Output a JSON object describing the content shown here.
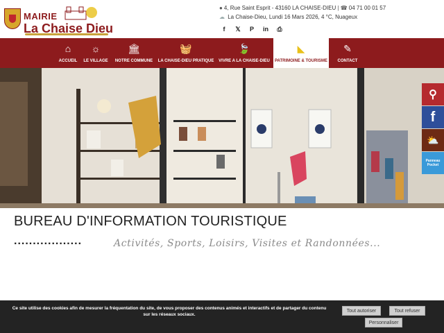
{
  "logo": {
    "mairie": "MAIRIE",
    "name": "La Chaise Dieu"
  },
  "contact": {
    "address": "4, Rue Saint Esprit - 43160 LA CHAISE-DIEU",
    "phone": "04 71 00 01 57",
    "weather_line": "La Chaise-Dieu, Lundi 16 Mars 2026, 4 °C, Nuageux"
  },
  "socials": [
    {
      "name": "facebook-icon",
      "glyph": "f"
    },
    {
      "name": "x-icon",
      "glyph": "𝕏"
    },
    {
      "name": "pinterest-icon",
      "glyph": "P"
    },
    {
      "name": "linkedin-icon",
      "glyph": "in"
    },
    {
      "name": "print-icon",
      "glyph": "⎙"
    }
  ],
  "nav": [
    {
      "label": "ACCUEIL",
      "icon": "home-icon",
      "glyph": "⌂"
    },
    {
      "label": "LE VILLAGE",
      "icon": "sun-icon",
      "glyph": "☼"
    },
    {
      "label": "NOTRE COMMUNE",
      "icon": "columns-icon",
      "glyph": "🏛"
    },
    {
      "label": "LA CHAISE-DIEU PRATIQUE",
      "icon": "basket-icon",
      "glyph": "🧺"
    },
    {
      "label": "VIVRE A LA CHAISE-DIEU",
      "icon": "leaf-icon",
      "glyph": "🍃"
    },
    {
      "label": "PATRIMOINE & TOURISME",
      "icon": "compass-icon",
      "glyph": "◣",
      "active": true
    },
    {
      "label": "CONTACT",
      "icon": "edit-icon",
      "glyph": "✎"
    }
  ],
  "side": {
    "pocket": "Panneau Pocket"
  },
  "page": {
    "title": "BUREAU D'INFORMATION TOURISTIQUE",
    "dots": "..................",
    "subtitle": "Activités, Sports, Loisirs, Visites et Randonnées..."
  },
  "cookie": {
    "text": "Ce site utilise des cookies afin de mesurer la fréquentation du site, de vous proposer des contenus animés et interactifs et de partager du contenu sur les réseaux sociaux.",
    "accept": "Tout autoriser",
    "refuse": "Tout refuser",
    "custom": "Personnaliser"
  },
  "colors": {
    "brand": "#8d1b1d",
    "accent": "#e9c11a",
    "cookie_bg": "#232323"
  }
}
